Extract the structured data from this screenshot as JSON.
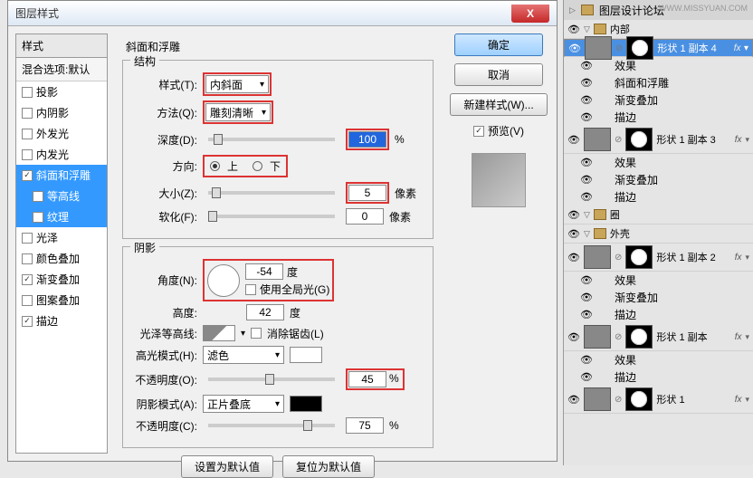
{
  "dialog": {
    "title": "图层样式",
    "left": {
      "header": "样式",
      "sub": "混合选项:默认",
      "items": [
        {
          "label": "投影",
          "checked": false
        },
        {
          "label": "内阴影",
          "checked": false
        },
        {
          "label": "外发光",
          "checked": false
        },
        {
          "label": "内发光",
          "checked": false
        },
        {
          "label": "斜面和浮雕",
          "checked": true,
          "selected": true
        },
        {
          "label": "等高线",
          "checked": false,
          "sub": true
        },
        {
          "label": "纹理",
          "checked": false,
          "sub": true
        },
        {
          "label": "光泽",
          "checked": false
        },
        {
          "label": "颜色叠加",
          "checked": false
        },
        {
          "label": "渐变叠加",
          "checked": true
        },
        {
          "label": "图案叠加",
          "checked": false
        },
        {
          "label": "描边",
          "checked": true
        }
      ]
    },
    "main": {
      "section_title": "斜面和浮雕",
      "structure": {
        "legend": "结构",
        "style_label": "样式(T):",
        "style_value": "内斜面",
        "method_label": "方法(Q):",
        "method_value": "雕刻清晰",
        "depth_label": "深度(D):",
        "depth_value": "100",
        "depth_unit": "%",
        "direction_label": "方向:",
        "dir_up": "上",
        "dir_down": "下",
        "size_label": "大小(Z):",
        "size_value": "5",
        "size_unit": "像素",
        "soften_label": "软化(F):",
        "soften_value": "0",
        "soften_unit": "像素"
      },
      "shading": {
        "legend": "阴影",
        "angle_label": "角度(N):",
        "angle_value": "-54",
        "angle_unit": "度",
        "global_label": "使用全局光(G)",
        "altitude_label": "高度:",
        "altitude_value": "42",
        "altitude_unit": "度",
        "gloss_label": "光泽等高线:",
        "antialias_label": "消除锯齿(L)",
        "hmode_label": "高光模式(H):",
        "hmode_value": "滤色",
        "hopacity_label": "不透明度(O):",
        "hopacity_value": "45",
        "pct": "%",
        "smode_label": "阴影模式(A):",
        "smode_value": "正片叠底",
        "sopacity_label": "不透明度(C):",
        "sopacity_value": "75"
      },
      "btn_default": "设置为默认值",
      "btn_reset": "复位为默认值"
    },
    "buttons": {
      "ok": "确定",
      "cancel": "取消",
      "newstyle": "新建样式(W)...",
      "preview": "预览(V)"
    }
  },
  "layers": {
    "header": "图层设计论坛",
    "watermark": "WWW.MISSYUAN.COM",
    "groups": [
      {
        "name": "内部",
        "items": [
          {
            "name": "形状 1 副本 4",
            "sel": true,
            "effects": [
              "效果",
              "斜面和浮雕",
              "渐变叠加",
              "描边"
            ]
          },
          {
            "name": "形状 1 副本 3",
            "effects": [
              "效果",
              "渐变叠加",
              "描边"
            ]
          }
        ]
      },
      {
        "name": "圈"
      },
      {
        "name": "外壳",
        "items": [
          {
            "name": "形状 1 副本 2",
            "effects": [
              "效果",
              "渐变叠加",
              "描边"
            ]
          },
          {
            "name": "形状 1 副本",
            "effects": [
              "效果",
              "描边"
            ]
          },
          {
            "name": "形状 1"
          }
        ]
      }
    ]
  }
}
